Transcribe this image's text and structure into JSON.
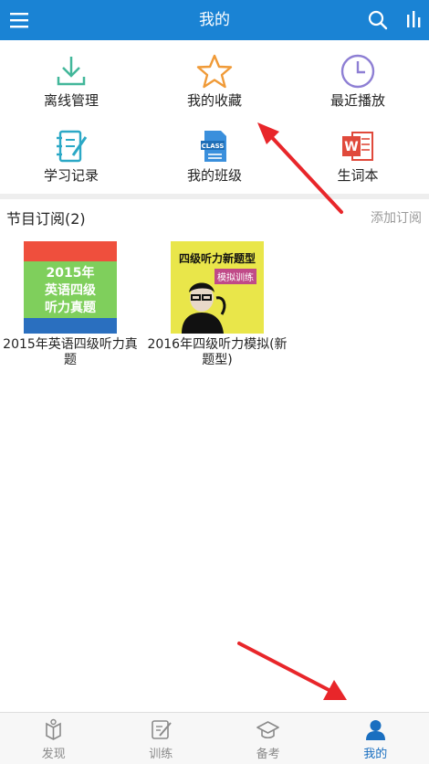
{
  "header": {
    "title": "我的",
    "background": "#1a83d4"
  },
  "grid": [
    {
      "label": "离线管理",
      "icon": "download-icon",
      "color": "#42b79a"
    },
    {
      "label": "我的收藏",
      "icon": "star-icon",
      "color": "#f09a37"
    },
    {
      "label": "最近播放",
      "icon": "clock-icon",
      "color": "#8e7fd4"
    },
    {
      "label": "学习记录",
      "icon": "notebook-icon",
      "color": "#2ba8c6"
    },
    {
      "label": "我的班级",
      "icon": "class-document-icon",
      "color": "#3a8fdc"
    },
    {
      "label": "生词本",
      "icon": "word-document-icon",
      "color": "#e0493b"
    }
  ],
  "subscriptions": {
    "heading": "节目订阅(2)",
    "add_label": "添加订阅",
    "items": [
      {
        "name": "2015年英语四级听力真题",
        "cover_lines": [
          "2015年",
          "英语四级",
          "听力真题"
        ]
      },
      {
        "name": "2016年四级听力模拟(新题型)",
        "cover_lines": [
          "四级听力新题型",
          "模拟训练"
        ]
      }
    ]
  },
  "tabs": [
    {
      "label": "发现",
      "icon": "discover-icon",
      "active": false
    },
    {
      "label": "训练",
      "icon": "practice-icon",
      "active": false
    },
    {
      "label": "备考",
      "icon": "graduation-cap-icon",
      "active": false
    },
    {
      "label": "我的",
      "icon": "user-icon",
      "active": true
    }
  ],
  "accent": "#1a6fc0",
  "annotation_color": "#e8262a"
}
